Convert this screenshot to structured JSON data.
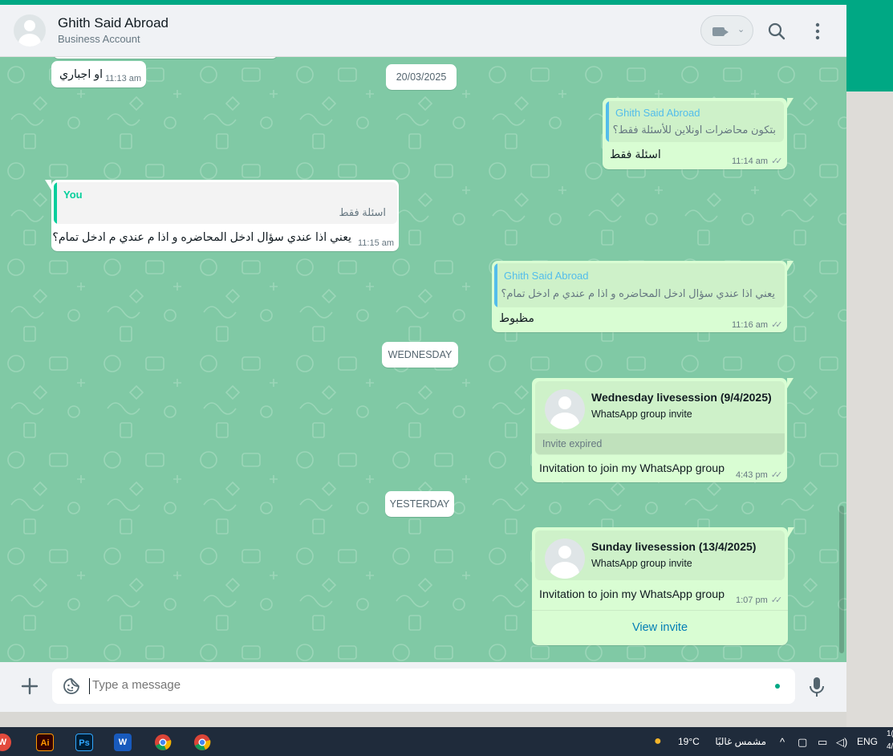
{
  "contact": {
    "name": "Ghith Said Abroad",
    "subtitle": "Business Account"
  },
  "header_icons": [
    "video-call-icon",
    "search-icon",
    "menu-icon"
  ],
  "messages": [
    {
      "text": "او اجباري",
      "time": "11:13 am"
    },
    {
      "quote_author": "Ghith Said Abroad",
      "quote_text": "بتكون محاضرات اونلاين للأسئلة فقط؟",
      "text": "اسئلة فقط",
      "time": "11:14 am"
    },
    {
      "quote_author": "You",
      "quote_text": "اسئلة فقط",
      "text": "يعني اذا عندي سؤال ادخل المحاضره و اذا م عندي م ادخل تمام؟",
      "time": "11:15 am"
    },
    {
      "quote_author": "Ghith Said Abroad",
      "quote_text": "يعني اذا عندي سؤال ادخل المحاضره و اذا م عندي م ادخل تمام؟",
      "text": "مظبوط",
      "time": "11:16 am"
    },
    {
      "invite_title": "Wednesday livesession (9/4/2025)",
      "invite_sub": "WhatsApp group invite",
      "status": "Invite expired",
      "text": "Invitation to join my WhatsApp group",
      "time": "4:43 pm"
    },
    {
      "invite_title": "Sunday livesession (13/4/2025)",
      "invite_sub": "WhatsApp group invite",
      "text": "Invitation to join my WhatsApp group",
      "time": "1:07 pm",
      "action": "View invite"
    }
  ],
  "date_chips": [
    "20/03/2025",
    "WEDNESDAY",
    "YESTERDAY"
  ],
  "composer": {
    "placeholder": "Type a message"
  },
  "taskbar": {
    "weather_temp": "19°C",
    "weather_text": "مشمس غالبًا",
    "lang": "ENG",
    "clock_partial": "1(",
    "date_partial": "4/",
    "apps": [
      "W",
      "Ai",
      "Ps",
      "W",
      "Chrome",
      "Chrome"
    ]
  },
  "colors": {
    "chat_bg": "#80c9a5",
    "outgoing": "#d9fdd3",
    "accent": "#00a884",
    "quote_you": "#06cf9c",
    "quote_other": "#53bdeb",
    "link": "#027eb5"
  }
}
